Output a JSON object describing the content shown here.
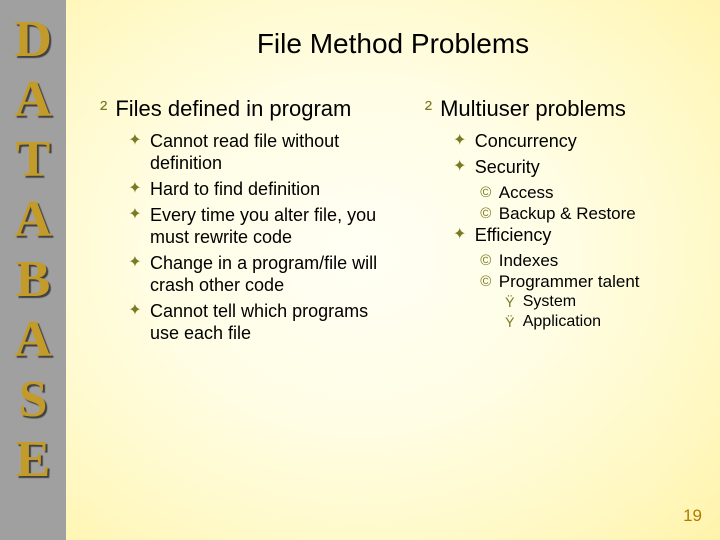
{
  "sidebar": {
    "letters": [
      "D",
      "A",
      "T",
      "A",
      "B",
      "A",
      "S",
      "E"
    ]
  },
  "title": "File Method Problems",
  "left": {
    "heading": "Files defined in program",
    "items": [
      "Cannot read file without definition",
      "Hard to find definition",
      "Every time you alter file, you must rewrite code",
      "Change in a program/file will crash other code",
      "Cannot tell which programs use each file"
    ]
  },
  "right": {
    "heading": "Multiuser problems",
    "items": {
      "a": "Concurrency",
      "b": "Security",
      "b_sub1": "Access",
      "b_sub2": "Backup & Restore",
      "c": "Efficiency",
      "c_sub1": "Indexes",
      "c_sub2": "Programmer talent",
      "c_sub2_a": "System",
      "c_sub2_b": "Application"
    }
  },
  "pagenum": "19",
  "bullets": {
    "l1": "²",
    "l2": "✦",
    "l3": "©",
    "l4": "Ÿ"
  }
}
